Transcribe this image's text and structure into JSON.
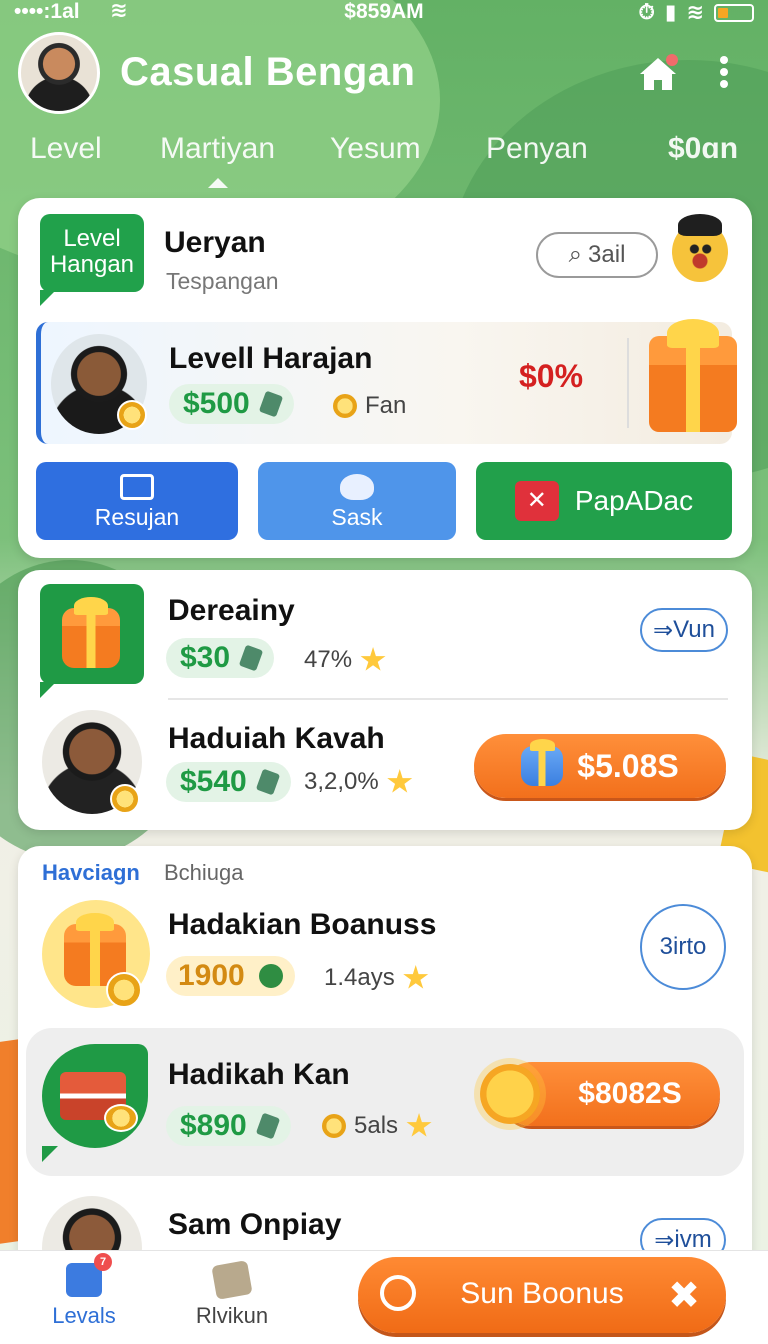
{
  "status_bar": {
    "signal": "••••:1al",
    "time": "$859AM"
  },
  "header": {
    "title": "Casual Bengan"
  },
  "tabs": [
    {
      "label": "Level"
    },
    {
      "label": "Martiyan"
    },
    {
      "label": "Yesum"
    },
    {
      "label": "Penyan"
    },
    {
      "label": "$0ɑn"
    }
  ],
  "profile": {
    "badge": "Level Hangan",
    "name": "Ueryan",
    "subtitle": "Tespangan",
    "pill": "3ail"
  },
  "featured": {
    "title": "Levell Harajan",
    "amount": "$500",
    "stat": "Fan",
    "percent": "$0%"
  },
  "actions": [
    {
      "label": "Resujan",
      "icon": "calendar-icon"
    },
    {
      "label": "Sask",
      "icon": "cloud-icon"
    },
    {
      "label": "PapADac",
      "icon": "close-icon"
    }
  ],
  "rewards": [
    {
      "title": "Dereainy",
      "amount": "$30",
      "stat": "47%",
      "action": "Vun"
    },
    {
      "title": "Haduiah Kavah",
      "amount": "$540",
      "stat": "3,2,0%",
      "action": "$5.08S"
    }
  ],
  "bonus_section": {
    "heading_left": "Havciagn",
    "heading_right": "Bchiuga",
    "items": [
      {
        "title": "Hadakian Boanuss",
        "amount": "1900",
        "stat": "1.4ays",
        "action": "3irto"
      },
      {
        "title": "Hadikah Kan",
        "amount": "$890",
        "stat": "5als",
        "action": "$8082S"
      },
      {
        "title": "Sam Onpiay",
        "action": "ivm"
      }
    ]
  },
  "bottom_nav": {
    "items": [
      {
        "label": "Levals",
        "badge": "7"
      },
      {
        "label": "Rlvikun"
      }
    ],
    "cta": "Sun Boonus"
  },
  "colors": {
    "brand_green": "#21a14b",
    "accent_orange": "#f2701c",
    "accent_blue": "#2f6fe0",
    "alert_red": "#d42020"
  }
}
